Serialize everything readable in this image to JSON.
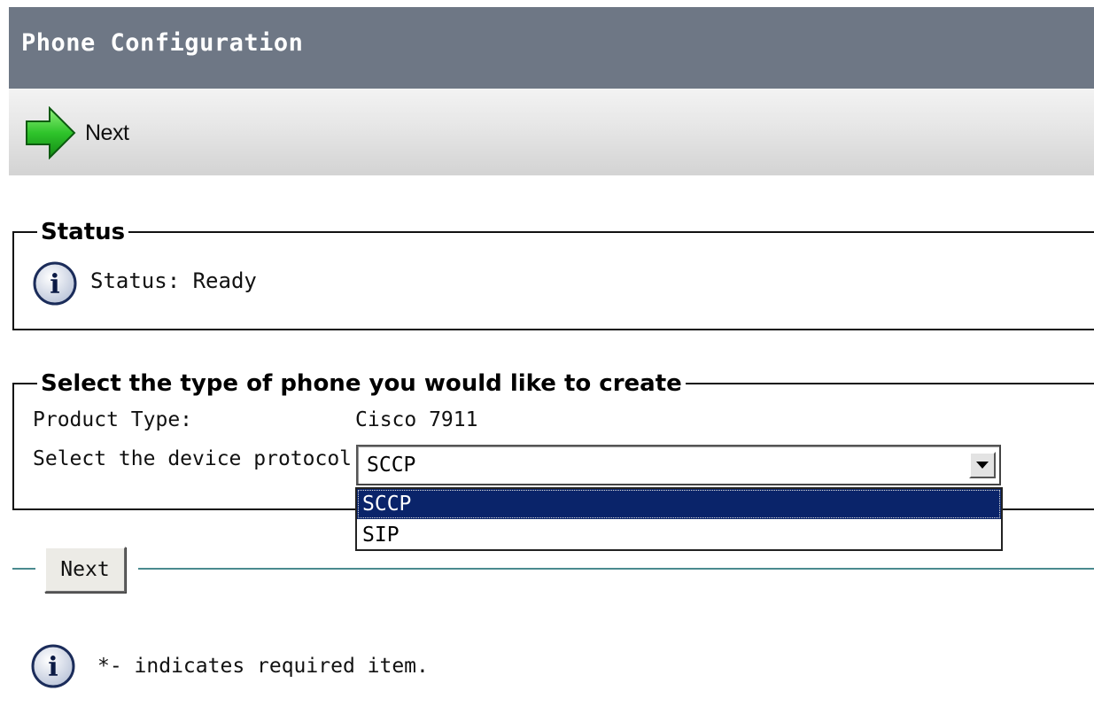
{
  "header": {
    "title": "Phone Configuration"
  },
  "toolbar": {
    "next_label": "Next"
  },
  "status": {
    "legend": "Status",
    "icon": "info-icon",
    "text": "Status: Ready"
  },
  "phone_type": {
    "legend": "Select the type of phone you would like to create",
    "product_type_label": "Product Type:",
    "product_type_value": "Cisco 7911",
    "protocol_label": "Select the device protocol:",
    "protocol_selected": "SCCP",
    "protocol_options": [
      "SCCP",
      "SIP"
    ]
  },
  "actions": {
    "next_button": "Next"
  },
  "footer": {
    "note": "*- indicates required item."
  },
  "colors": {
    "header_bg": "#6e7785",
    "selected_option_bg": "#0a246a",
    "divider": "#4a8a8f"
  }
}
